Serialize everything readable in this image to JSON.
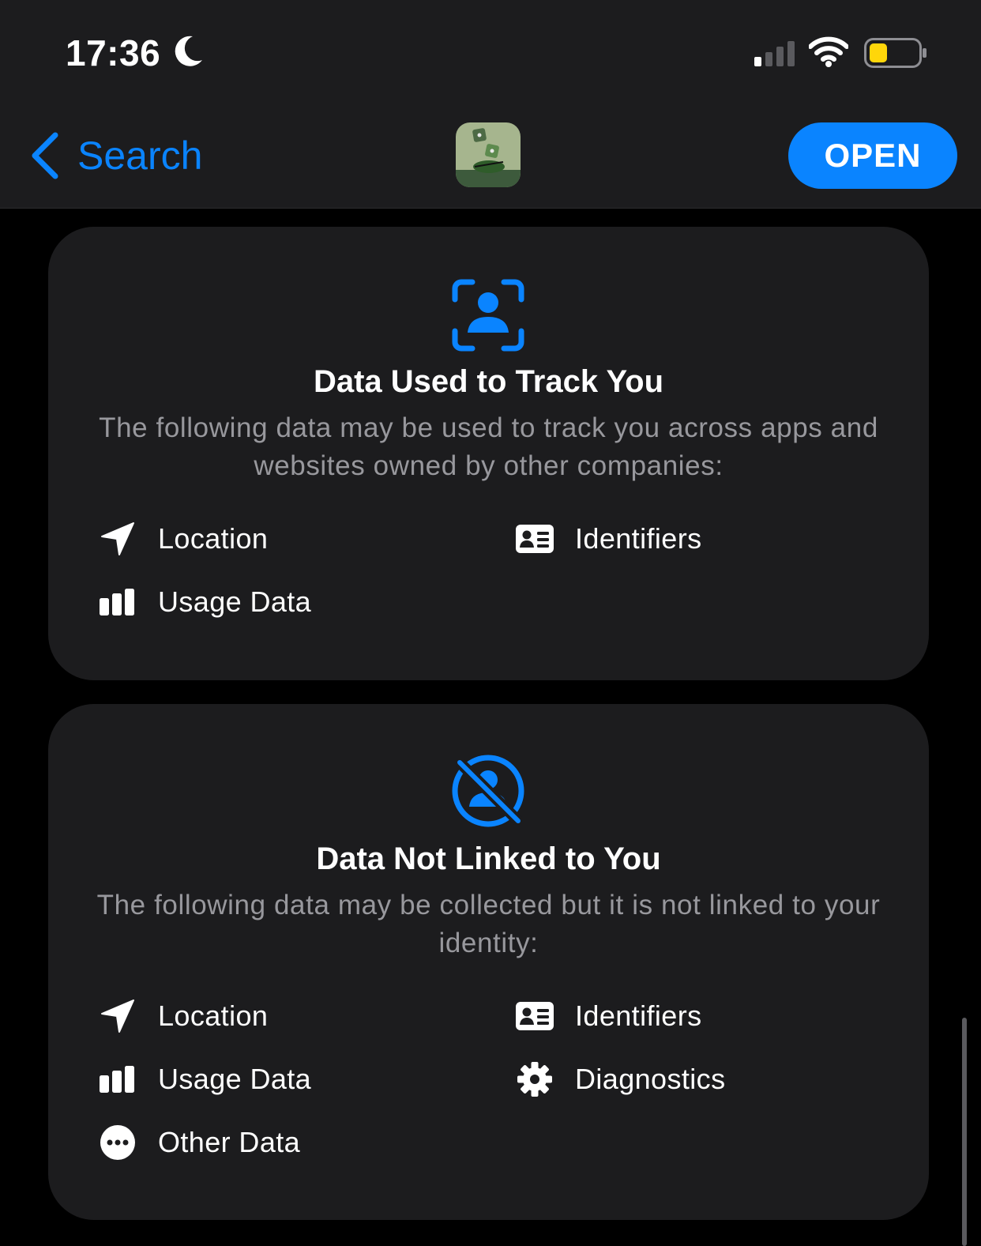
{
  "status_bar": {
    "time": "17:36"
  },
  "nav": {
    "back_label": "Search",
    "open_label": "OPEN"
  },
  "colors": {
    "accent": "#0a84ff",
    "battery": "#ffd60a",
    "card_bg": "#1c1c1e",
    "secondary_text": "#98989d"
  },
  "sections": [
    {
      "icon": "person-viewfinder-icon",
      "title": "Data Used to Track You",
      "description": "The following data may be used to track you across apps and websites owned by other companies:",
      "items": [
        {
          "label": "Location",
          "icon": "location-arrow-icon"
        },
        {
          "label": "Identifiers",
          "icon": "id-card-icon"
        },
        {
          "label": "Usage Data",
          "icon": "bar-chart-icon"
        }
      ]
    },
    {
      "icon": "person-crossed-icon",
      "title": "Data Not Linked to You",
      "description": "The following data may be collected but it is not linked to your identity:",
      "items": [
        {
          "label": "Location",
          "icon": "location-arrow-icon"
        },
        {
          "label": "Identifiers",
          "icon": "id-card-icon"
        },
        {
          "label": "Usage Data",
          "icon": "bar-chart-icon"
        },
        {
          "label": "Diagnostics",
          "icon": "gear-icon"
        },
        {
          "label": "Other Data",
          "icon": "ellipsis-circle-icon"
        }
      ]
    }
  ]
}
